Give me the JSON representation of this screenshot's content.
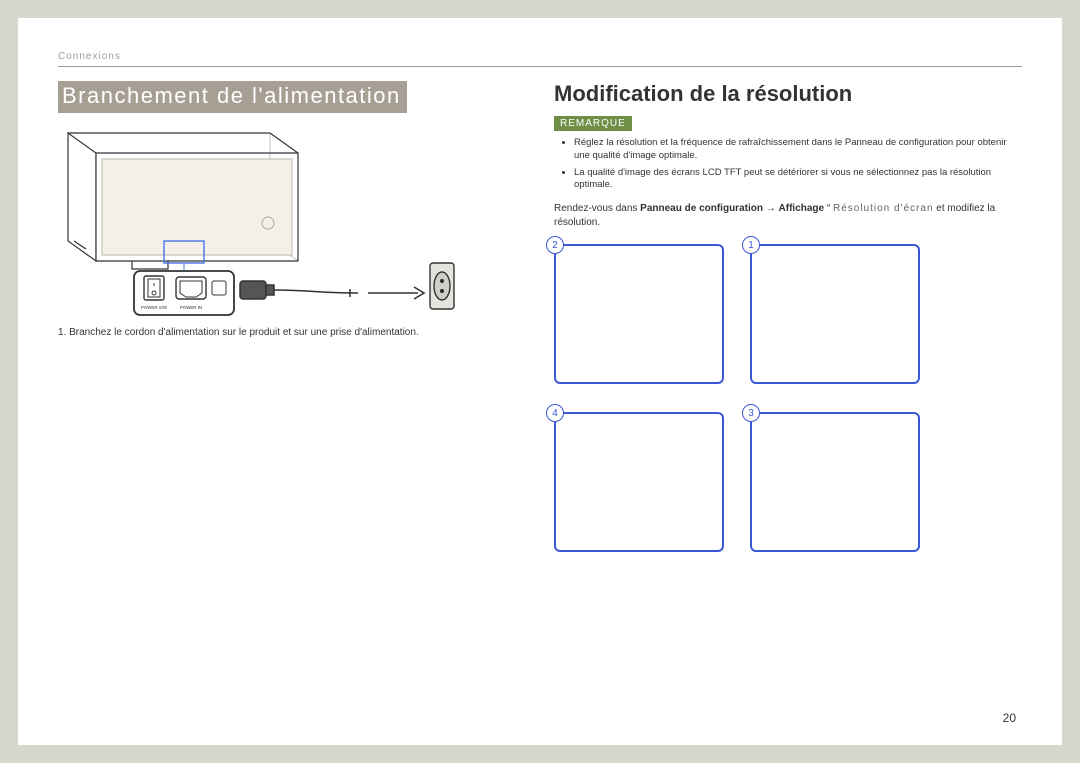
{
  "header": {
    "section": "Connexions"
  },
  "left": {
    "heading": "Branchement de l'alimentation",
    "ports": {
      "switch": "POWER S/W",
      "inlet": "POWER IN"
    },
    "step1": "1.  Branchez le cordon d'alimentation sur le produit et sur une prise d'alimentation."
  },
  "right": {
    "heading": "Modification de la résolution",
    "remark_label": "REMARQUE",
    "bullets": [
      "Réglez la résolution et la fréquence de rafraîchissement dans le Panneau de configuration pour obtenir une qualité d'image optimale.",
      "La qualité d'image des écrans LCD TFT peut se détériorer si vous ne sélectionnez pas la résolution optimale."
    ],
    "instruction": {
      "pre": "Rendez-vous dans ",
      "bold1": "Panneau de configuration",
      "arrow": " → ",
      "bold2": "Affichage",
      "quote": " “ ",
      "spaced": "Résolution d'écran",
      "post": " et modifiez la résolution."
    },
    "box_numbers": [
      "2",
      "1",
      "4",
      "3"
    ]
  },
  "page_number": "20"
}
